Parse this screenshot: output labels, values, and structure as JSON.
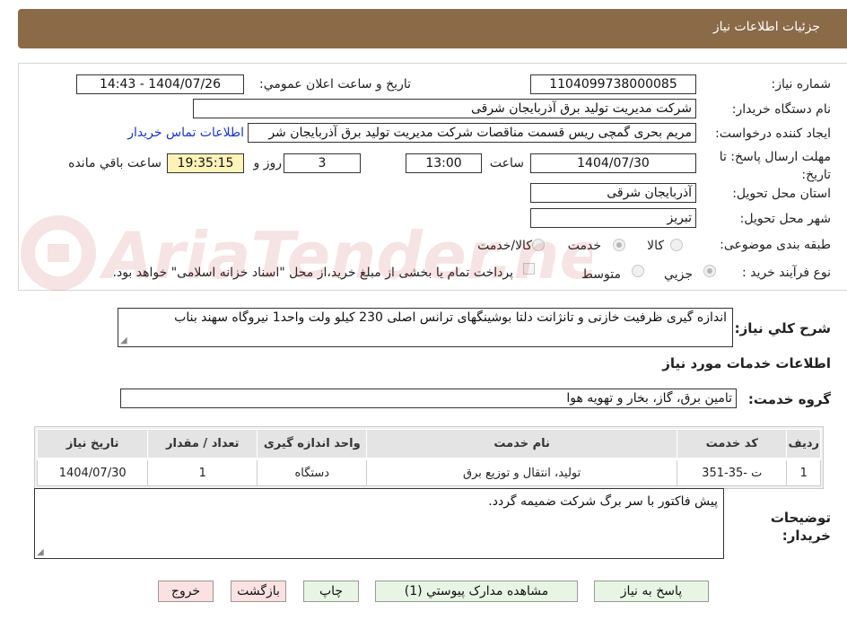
{
  "header": {
    "title": "جزئیات اطلاعات نیاز"
  },
  "fields": {
    "need_number_label": "شماره نیاز:",
    "need_number": "1104099738000085",
    "announce_label": "تاریخ و ساعت اعلان عمومي:",
    "announce_value": "1404/07/26 - 14:43",
    "buyer_org_label": "نام دستگاه خريدار:",
    "buyer_org": "شرکت مدیریت تولید برق آذربایجان شرقی",
    "creator_label": "ايجاد کننده درخواست:",
    "creator": "مریم بحری گمچی ریس قسمت مناقصات شرکت مدیریت تولید برق آذربایجان شر",
    "contact_link": "اطلاعات تماس خريدار",
    "deadline_label": "مهلت ارسال پاسخ: تا تاريخ:",
    "deadline_date": "1404/07/30",
    "time_label": "ساعت",
    "deadline_time": "13:00",
    "days_value": "3",
    "days_label": "روز و",
    "remaining_time": "19:35:15",
    "remaining_label": "ساعت باقي مانده",
    "province_label": "استان محل تحويل:",
    "province": "آذربایجان شرقی",
    "city_label": "شهر محل تحويل:",
    "city": "تبریز",
    "category_label": "طبقه بندی موضوعی:",
    "category_options": [
      "کالا",
      "خدمت",
      "کالا/خدمت"
    ],
    "category_selected": "خدمت",
    "process_label": "نوع فرآيند خريد :",
    "process_options": [
      "جزيي",
      "متوسط"
    ],
    "payment_note": "پرداخت تمام یا بخشی از مبلغ خرید،از محل \"اسناد خزانه اسلامی\" خواهد بود."
  },
  "watermark": {
    "text": "AriaTender.neT"
  },
  "summary": {
    "label": "شرح كلي نياز:",
    "text": "اندازه گیری ظرفیت خازنی و تانژانت دلتا بوشینگهای ترانس اصلی  230 کیلو ولت واحد1 نیروگاه سهند بناب"
  },
  "services": {
    "section_title": "اطلاعات خدمات مورد نياز",
    "group_label": "گروه خدمت:",
    "group_value": "تامين برق، گاز، بخار و تهويه هوا",
    "columns": [
      "رديف",
      "کد خدمت",
      "نام خدمت",
      "واحد اندازه گیری",
      "تعداد / مقدار",
      "تاریخ نیاز"
    ],
    "rows": [
      [
        "1",
        "ت -35-351",
        "تولید، انتقال و توزیع برق",
        "دستگاه",
        "1",
        "1404/07/30"
      ]
    ]
  },
  "buyer_notes": {
    "label": "توضيحات خريدار:",
    "text": "پیش فاکتور با سر برگ شرکت ضمیمه گردد."
  },
  "buttons": {
    "reply": "پاسخ به نياز",
    "docs": "مشاهده مدارک پيوستي (1)",
    "print": "چاپ",
    "back": "بازگشت",
    "exit": "خروج"
  }
}
